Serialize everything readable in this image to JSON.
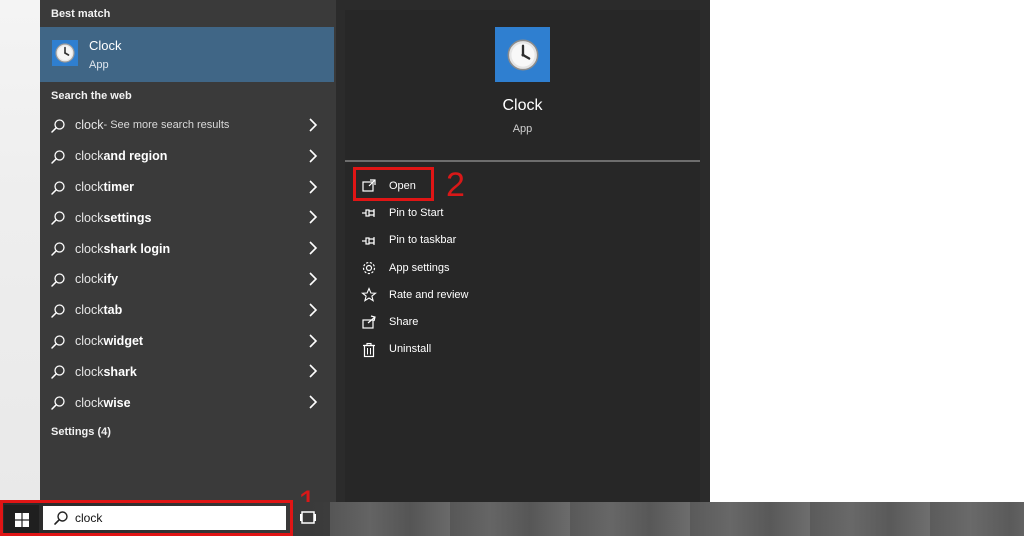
{
  "best_match": {
    "section_label": "Best match",
    "title": "Clock",
    "subtitle": "App",
    "icon": "clock-app-icon"
  },
  "web": {
    "section_label": "Search the web",
    "items": [
      {
        "light": "clock",
        "bold": "",
        "tail": " - See more search results"
      },
      {
        "light": "clock ",
        "bold": "and region",
        "tail": ""
      },
      {
        "light": "clock ",
        "bold": "timer",
        "tail": ""
      },
      {
        "light": "clock ",
        "bold": "settings",
        "tail": ""
      },
      {
        "light": "clock",
        "bold": "shark login",
        "tail": ""
      },
      {
        "light": "clock",
        "bold": "ify",
        "tail": ""
      },
      {
        "light": "clock",
        "bold": "tab",
        "tail": ""
      },
      {
        "light": "clock ",
        "bold": "widget",
        "tail": ""
      },
      {
        "light": "clock",
        "bold": "shark",
        "tail": ""
      },
      {
        "light": "clock",
        "bold": "wise",
        "tail": ""
      }
    ]
  },
  "settings_section": {
    "label": "Settings (4)"
  },
  "detail": {
    "title": "Clock",
    "subtitle": "App",
    "actions": [
      {
        "label": "Open",
        "icon": "open-icon"
      },
      {
        "label": "Pin to Start",
        "icon": "pin-icon"
      },
      {
        "label": "Pin to taskbar",
        "icon": "pin-icon"
      },
      {
        "label": "App settings",
        "icon": "gear-icon"
      },
      {
        "label": "Rate and review",
        "icon": "star-icon"
      },
      {
        "label": "Share",
        "icon": "share-icon"
      },
      {
        "label": "Uninstall",
        "icon": "trash-icon"
      }
    ]
  },
  "annotations": {
    "step1": "1",
    "step2": "2",
    "color": "#e01515"
  },
  "taskbar": {
    "search_value": "clock",
    "start_icon": "windows-logo-icon",
    "search_icon": "search-icon",
    "task_view_icon": "task-view-icon"
  }
}
